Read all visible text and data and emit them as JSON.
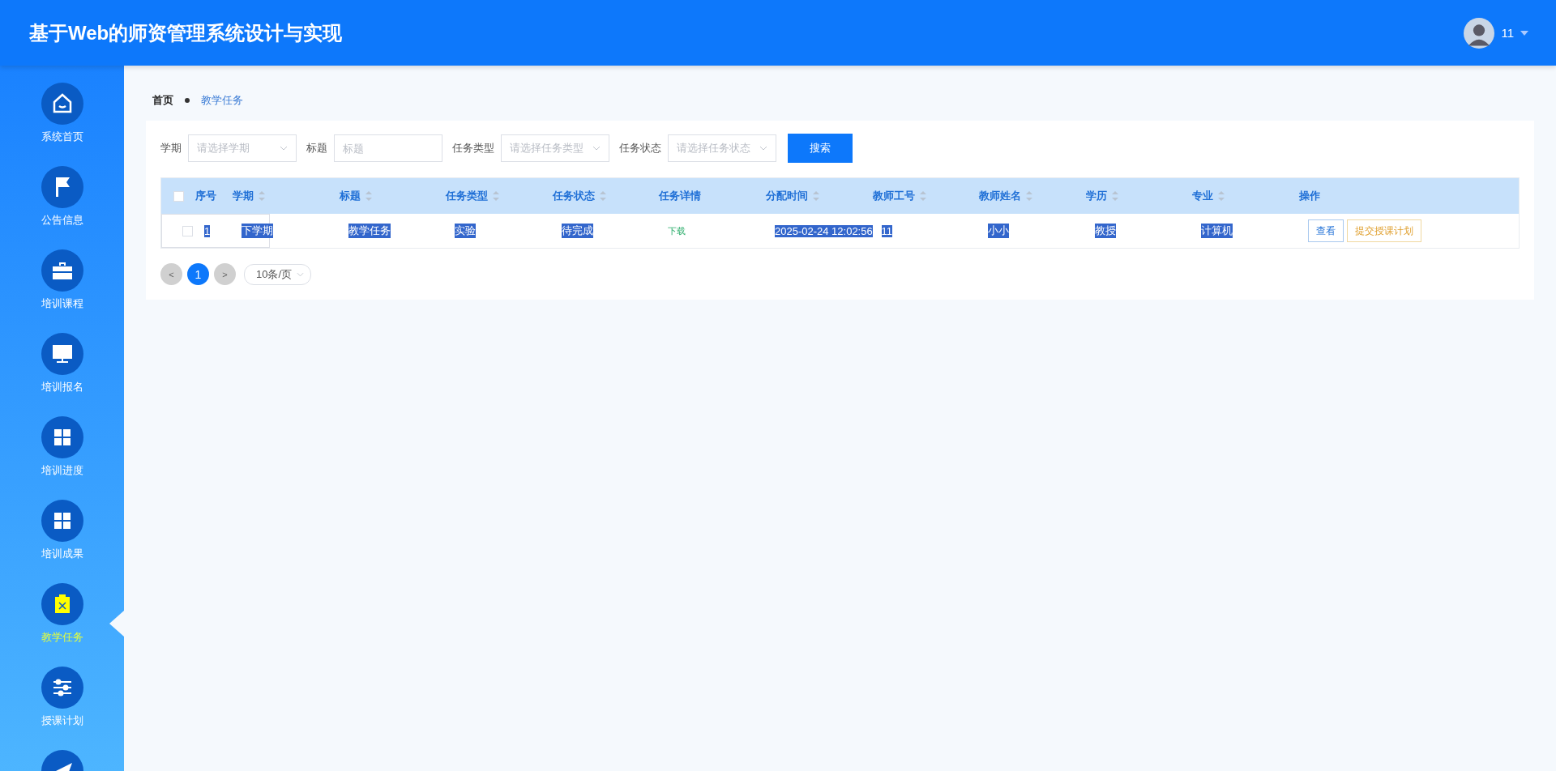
{
  "header": {
    "title": "基于Web的师资管理系统设计与实现",
    "user": "11"
  },
  "sidebar": {
    "items": [
      {
        "label": "系统首页",
        "selected": false
      },
      {
        "label": "公告信息",
        "selected": false
      },
      {
        "label": "培训课程",
        "selected": false
      },
      {
        "label": "培训报名",
        "selected": false
      },
      {
        "label": "培训进度",
        "selected": false
      },
      {
        "label": "培训成果",
        "selected": false
      },
      {
        "label": "教学任务",
        "selected": true
      },
      {
        "label": "授课计划",
        "selected": false
      },
      {
        "selected": false
      }
    ]
  },
  "breadcrumb": [
    "首页",
    "教学任务"
  ],
  "filters": [
    {
      "kind": "select",
      "label": "学期",
      "placeholder": "请选择学期"
    },
    {
      "kind": "text",
      "label": "标题",
      "placeholder": "标题"
    },
    {
      "kind": "select",
      "label": "任务类型",
      "placeholder": "请选择任务类型"
    },
    {
      "kind": "select",
      "label": "任务状态",
      "placeholder": "请选择任务状态"
    }
  ],
  "search_button": "搜索",
  "table": {
    "all_checked": false,
    "columns": [
      {
        "label": "序号",
        "sortable": false
      },
      {
        "label": "学期",
        "sortable": true
      },
      {
        "label": "标题",
        "sortable": true
      },
      {
        "label": "任务类型",
        "sortable": true
      },
      {
        "label": "任务状态",
        "sortable": true
      },
      {
        "label": "任务详情",
        "sortable": false
      },
      {
        "label": "分配时间",
        "sortable": true
      },
      {
        "label": "教师工号",
        "sortable": true
      },
      {
        "label": "教师姓名",
        "sortable": true
      },
      {
        "label": "学历",
        "sortable": true
      },
      {
        "label": "专业",
        "sortable": true
      },
      {
        "label": "操作",
        "sortable": false
      }
    ],
    "rows": [
      {
        "checked": false,
        "text_selected": true,
        "cells": [
          "1",
          "下学期",
          "教学任务",
          "实验",
          "待完成"
        ],
        "detail_link": "下载",
        "cells_after": [
          "2025-02-24 12:02:56",
          "11",
          "小小",
          "教授",
          "计算机"
        ],
        "actions": [
          "查看",
          "提交授课计划"
        ]
      }
    ]
  },
  "pagination": {
    "prev": "<",
    "pages": [
      {
        "label": "1",
        "selected": true
      }
    ],
    "next": ">",
    "page_size": "10条/页"
  }
}
